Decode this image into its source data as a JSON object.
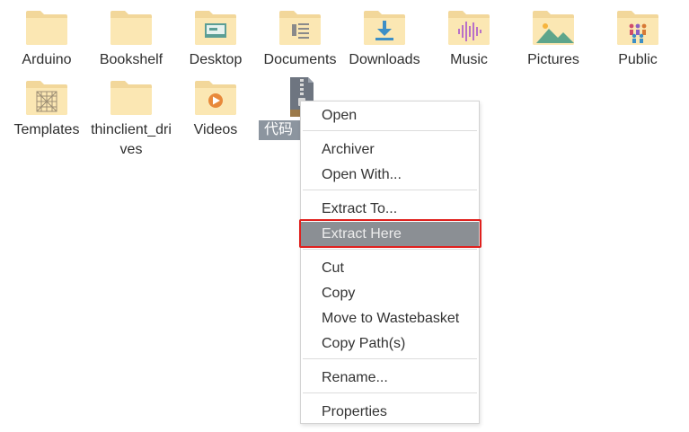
{
  "desktop": {
    "files": [
      {
        "label": "Arduino",
        "icon": "folder-icon"
      },
      {
        "label": "Bookshelf",
        "icon": "folder-icon"
      },
      {
        "label": "Desktop",
        "icon": "desktop-folder-icon"
      },
      {
        "label": "Documents",
        "icon": "documents-folder-icon"
      },
      {
        "label": "Downloads",
        "icon": "downloads-folder-icon"
      },
      {
        "label": "Music",
        "icon": "music-folder-icon"
      },
      {
        "label": "Pictures",
        "icon": "pictures-folder-icon"
      },
      {
        "label": "Public",
        "icon": "public-folder-icon"
      },
      {
        "label": "Templates",
        "icon": "templates-folder-icon"
      },
      {
        "label": "thinclient_drives",
        "icon": "folder-icon"
      },
      {
        "label": "Videos",
        "icon": "videos-folder-icon"
      },
      {
        "label": "代码",
        "icon": "archive-file-icon",
        "selected": true
      }
    ]
  },
  "context_menu": {
    "items": [
      {
        "label": "Open"
      },
      {
        "label": "Archiver"
      },
      {
        "label": "Open With..."
      },
      {
        "label": "Extract To..."
      },
      {
        "label": "Extract Here",
        "highlighted": true
      },
      {
        "label": "Cut"
      },
      {
        "label": "Copy"
      },
      {
        "label": "Move to Wastebasket"
      },
      {
        "label": "Copy Path(s)"
      },
      {
        "label": "Rename..."
      },
      {
        "label": "Properties"
      }
    ]
  },
  "colors": {
    "folder_back": "#f2d79a",
    "folder_front": "#fbe7b3",
    "selection_bg": "#8c959f",
    "menu_highlight": "#8b8f94",
    "callout_red": "#e0201d"
  }
}
